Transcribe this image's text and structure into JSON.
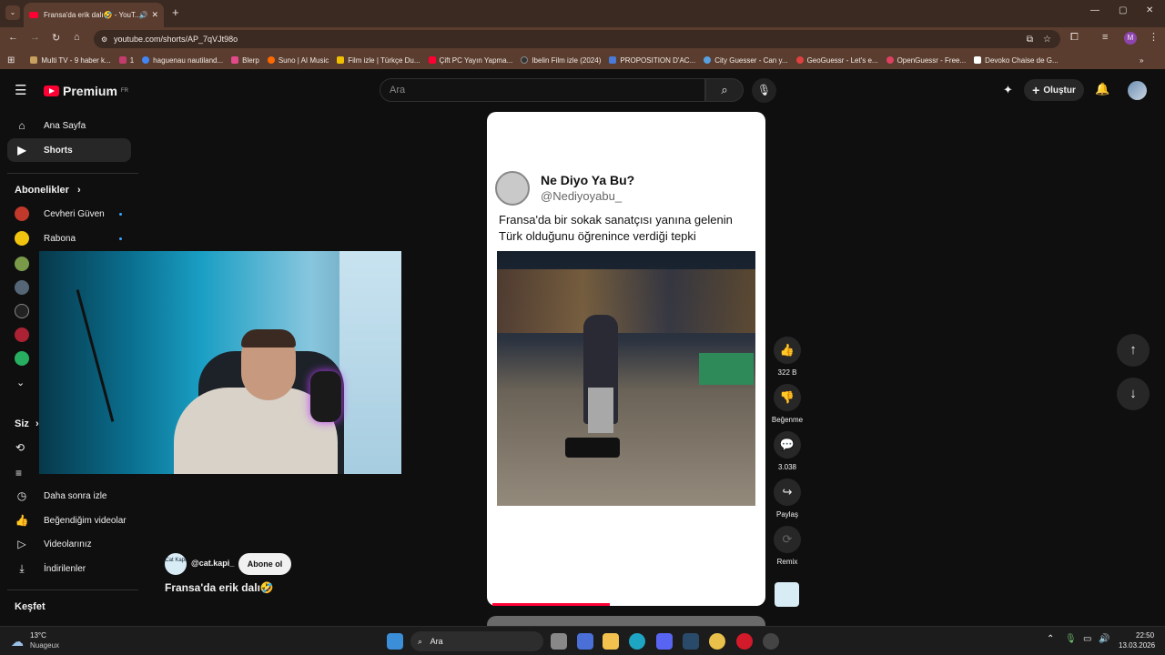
{
  "browser": {
    "tab_title": "Fransa'da erik dalı🤣 - YouT...",
    "url": "youtube.com/shorts/AP_7qVJt98o",
    "bookmarks": [
      {
        "label": "Multi TV - 9 haber k...",
        "color": "#c8a060"
      },
      {
        "label": "1",
        "color": "#c43b6e"
      },
      {
        "label": "haguenau nautiland...",
        "color": "#4285f4"
      },
      {
        "label": "Blerp",
        "color": "#e24a8a"
      },
      {
        "label": "Suno | AI Music",
        "color": "#ff6a00"
      },
      {
        "label": "Film izle | Türkçe Du...",
        "color": "#f0c000"
      },
      {
        "label": "Çift PC Yayın Yapma...",
        "color": "#ff0033"
      },
      {
        "label": "Ibelin Film izle (2024)",
        "color": "#333333"
      },
      {
        "label": "PROPOSITION D'AC...",
        "color": "#4a7bd6"
      },
      {
        "label": "City Guesser - Can y...",
        "color": "#5aa0e0"
      },
      {
        "label": "GeoGuessr - Let's e...",
        "color": "#e04040"
      },
      {
        "label": "OpenGuessr - Free...",
        "color": "#e04060"
      },
      {
        "label": "Devoko Chaise de G...",
        "color": "#ffffff"
      }
    ]
  },
  "youtube": {
    "logo_text": "Premium",
    "logo_region": "FR",
    "search_placeholder": "Ara",
    "create_label": "Oluştur",
    "nav": [
      {
        "label": "Ana Sayfa",
        "icon": "home-icon",
        "glyph": "⌂"
      },
      {
        "label": "Shorts",
        "icon": "shorts-icon",
        "glyph": "▶"
      }
    ],
    "subscriptions_title": "Abonelikler",
    "subscriptions": [
      {
        "label": "Cevheri Güven",
        "color": "#c0392b"
      },
      {
        "label": "Rabona",
        "color": "#f1c40f"
      }
    ],
    "you_title": "Siz",
    "you_items": [
      {
        "label": "Daha sonra izle",
        "icon": "clock-icon",
        "glyph": "◷"
      },
      {
        "label": "Beğendiğim videolar",
        "icon": "thumb-up-icon",
        "glyph": "👍"
      },
      {
        "label": "Videolarınız",
        "icon": "video-icon",
        "glyph": "▷"
      },
      {
        "label": "İndirilenler",
        "icon": "download-icon",
        "glyph": "⤓"
      }
    ],
    "explore_title": "Keşfet",
    "channel": {
      "handle": "@cat.kapi_",
      "avatar_text": "Cat Kapı",
      "subscribe_label": "Abone ol"
    },
    "short_title": "Fransa'da erik dalı🤣",
    "post": {
      "account_name": "Ne Diyo Ya Bu?",
      "account_handle": "@Nediyoyabu_",
      "caption_line1": "Fransa'da bir sokak sanatçısı yanına gelenin",
      "caption_line2": "Türk olduğunu öğrenince verdiği tepki"
    },
    "actions": [
      {
        "label": "322 B",
        "icon": "like-icon",
        "glyph": "👍"
      },
      {
        "label": "Beğenme",
        "icon": "dislike-icon",
        "glyph": "👎"
      },
      {
        "label": "3.038",
        "icon": "comment-icon",
        "glyph": "💬"
      },
      {
        "label": "Paylaş",
        "icon": "share-icon",
        "glyph": "↪"
      },
      {
        "label": "Remix",
        "icon": "remix-icon",
        "glyph": "⟳"
      }
    ]
  },
  "taskbar": {
    "weather_temp": "13°C",
    "weather_desc": "Nuageux",
    "search_label": "Ara",
    "time": "22:50",
    "date": "13.03.2026"
  }
}
